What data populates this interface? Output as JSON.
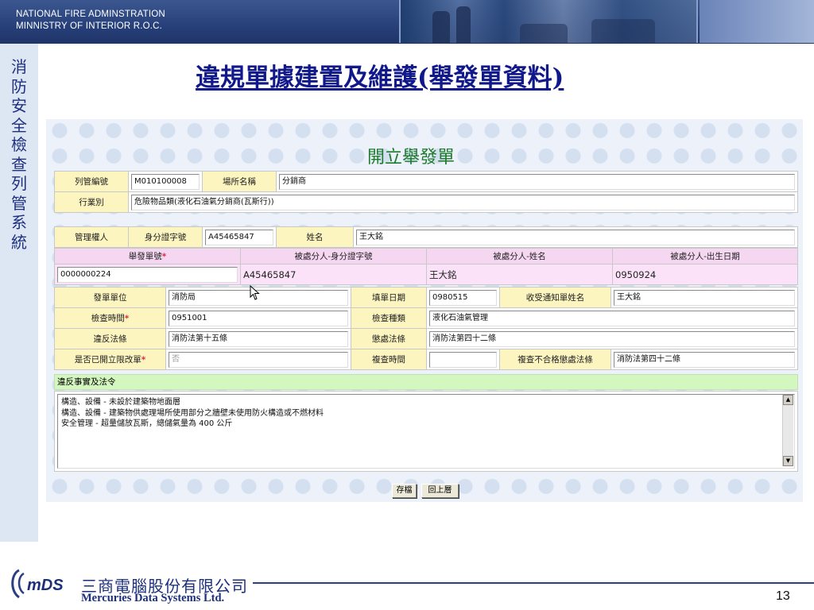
{
  "header": {
    "org_line1": "NATIONAL FIRE ADMINSTRATION",
    "org_line2": "MINNISTRY OF INTERIOR R.O.C."
  },
  "sidebar": {
    "text": "消防安全檢查列管系統"
  },
  "slide_title": "違規單據建置及維護(舉發單資料)",
  "form": {
    "title": "開立舉發單",
    "row1": {
      "control_no_label": "列管編號",
      "control_no_value": "M010100008",
      "place_name_label": "場所名稱",
      "place_name_value": "分銷商"
    },
    "row2": {
      "business_label": "行業別",
      "business_value": "危險物品類(液化石油氣分銷商(瓦斯行))"
    },
    "manager": {
      "label": "管理權人",
      "id_label": "身分證字號",
      "id_value": "A45465847",
      "name_label": "姓名",
      "name_value": "王大銘"
    },
    "ticket": {
      "col1": "舉發單號",
      "col2": "被處分人-身分證字號",
      "col3": "被處分人-姓名",
      "col4": "被處分人-出生日期",
      "ticket_no": "0000000224",
      "id_no": "A45465847",
      "name": "王大銘",
      "birth": "0950924"
    },
    "details": {
      "issuer_label": "發單單位",
      "issuer_value": "消防局",
      "fill_date_label": "填單日期",
      "fill_date_value": "0980515",
      "recipient_label": "收受通知單姓名",
      "recipient_value": "王大銘",
      "inspect_time_label": "檢查時間",
      "inspect_time_value": "0951001",
      "inspect_type_label": "檢查種類",
      "inspect_type_value": "液化石油氣管理",
      "violation_law_label": "違反法條",
      "violation_law_value": "消防法第十五條",
      "penalty_law_label": "懲處法條",
      "penalty_law_value": "消防法第四十二條",
      "deadline_label": "是否已開立限改單",
      "deadline_value": "否",
      "recheck_time_label": "複查時間",
      "recheck_time_value": "",
      "recheck_fail_label": "複查不合格懲處法條",
      "recheck_fail_value": "消防法第四十二條"
    },
    "facts": {
      "label": "違反事實及法令",
      "text": "構造、設備 - 未設於建築物地面層\n構造、設備 - 建築物供處理場所使用部分之牆壁未使用防火構造或不燃材料\n安全管理 - 超量儲放瓦斯，總儲氣量為 400 公斤"
    },
    "buttons": {
      "save": "存檔",
      "back": "回上層"
    }
  },
  "footer": {
    "logo_text": "mDS",
    "company_cn": "三商電腦股份有限公司",
    "company_en": "Mercuries Data Systems Ltd.",
    "page_number": "13"
  },
  "colors": {
    "header_blue": "#27407a",
    "title_blue": "#10188a",
    "label_yellow": "#fdf5c0",
    "ticket_pink": "#f6d7f2",
    "facts_green": "#d4f7c0",
    "required_red": "#e0102a",
    "form_title_green": "#1c7a2c"
  }
}
